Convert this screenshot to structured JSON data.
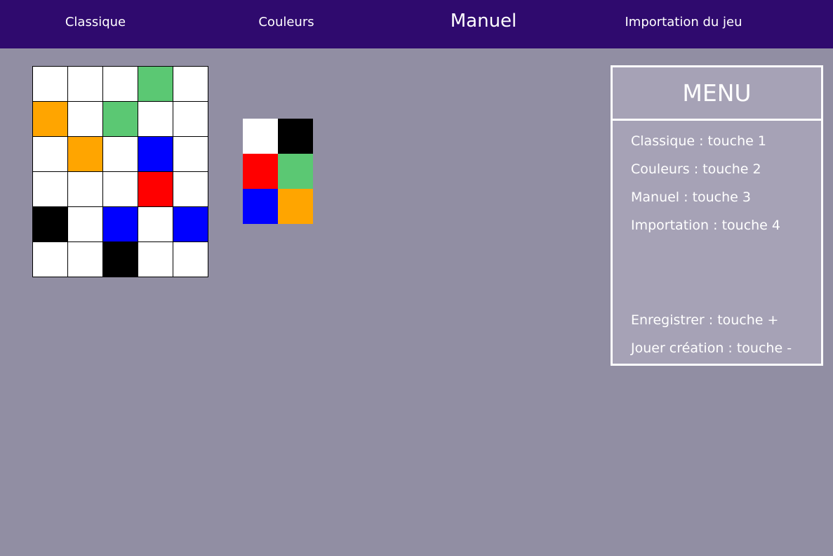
{
  "nav": {
    "items": [
      {
        "label": "Classique",
        "active": false
      },
      {
        "label": "Couleurs",
        "active": false
      },
      {
        "label": "Manuel",
        "active": true
      },
      {
        "label": "Importation du jeu",
        "active": false
      }
    ]
  },
  "colors": {
    "white": "#ffffff",
    "green": "#5bc873",
    "orange": "#ffa500",
    "blue": "#0000ff",
    "red": "#ff0000",
    "black": "#000000",
    "topbar": "#2f0a6e",
    "background": "#918ea3",
    "menu_panel": "#a6a2b6"
  },
  "board": {
    "rows": 6,
    "cols": 5,
    "cells": [
      [
        "white",
        "white",
        "white",
        "green",
        "white"
      ],
      [
        "orange",
        "white",
        "green",
        "white",
        "white"
      ],
      [
        "white",
        "orange",
        "white",
        "blue",
        "white"
      ],
      [
        "white",
        "white",
        "white",
        "red",
        "white"
      ],
      [
        "black",
        "white",
        "blue",
        "white",
        "blue"
      ],
      [
        "white",
        "white",
        "black",
        "white",
        "white"
      ]
    ]
  },
  "palette": [
    "white",
    "black",
    "red",
    "green",
    "blue",
    "orange"
  ],
  "menu": {
    "title": "MENU",
    "lines": [
      "Classique : touche 1",
      "Couleurs : touche 2",
      "Manuel : touche 3",
      "Importation : touche 4"
    ],
    "actions": [
      "Enregistrer : touche +",
      "Jouer création : touche -"
    ]
  }
}
